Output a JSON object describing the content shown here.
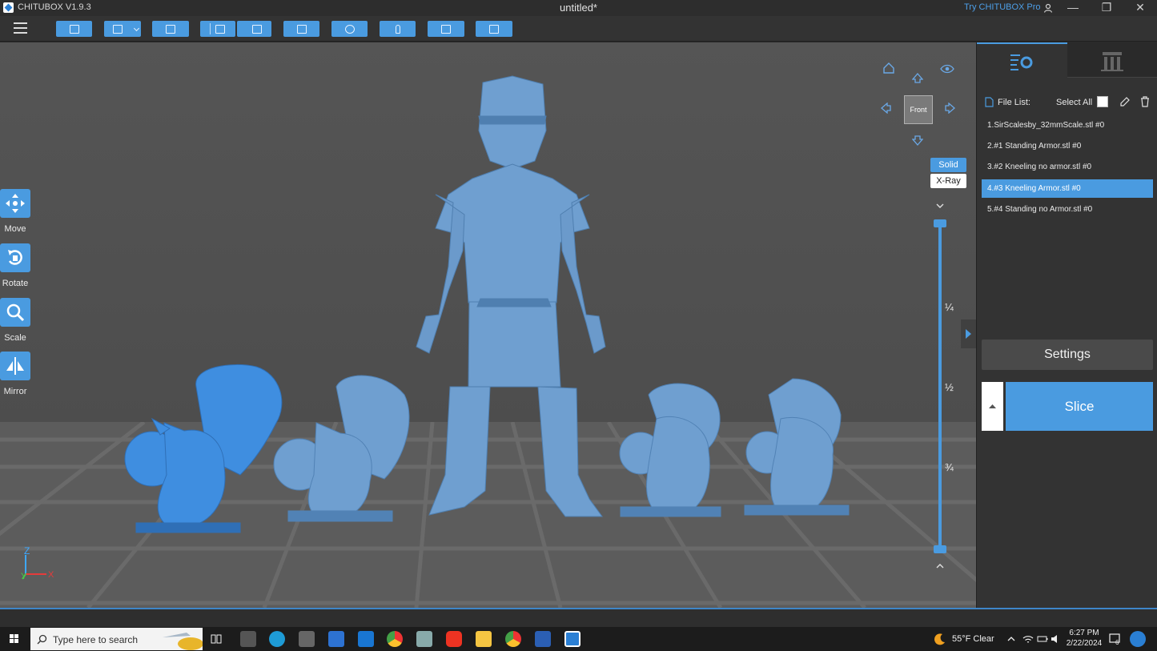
{
  "window": {
    "app_name": "CHITUBOX V1.9.3",
    "document_title": "untitled*",
    "try_pro": "Try CHITUBOX Pro",
    "controls": {
      "minimize": "—",
      "restore": "❐",
      "close": "✕"
    }
  },
  "toolbar": {
    "buttons": [
      "open-file-icon",
      "save-icon",
      "import-icon",
      "undo-icon",
      "redo-icon",
      "copy-icon",
      "arrange-icon",
      "support-icon",
      "hollow-icon",
      "dig-hole-icon"
    ]
  },
  "left_tools": {
    "move": "Move",
    "rotate": "Rotate",
    "scale": "Scale",
    "mirror": "Mirror"
  },
  "viewport": {
    "view_cube_label": "Front",
    "solid": "Solid",
    "xray": "X-Ray",
    "layer_fractions": [
      "¼",
      "½",
      "¾"
    ],
    "axis_z": "Z",
    "axis_y": "Y",
    "axis_x": "X"
  },
  "right_panel": {
    "file_list_label": "File List:",
    "select_all": "Select All",
    "files": [
      "1.SirScalesby_32mmScale.stl #0",
      "2.#1 Standing Armor.stl #0",
      "3.#2 Kneeling no armor.stl #0",
      "4.#3 Kneeling Armor.stl #0",
      "5.#4 Standing no Armor.stl #0"
    ],
    "selected_index": 3,
    "settings": "Settings",
    "slice": "Slice"
  },
  "taskbar": {
    "search_placeholder": "Type here to search",
    "weather": "55°F  Clear",
    "time": "6:27 PM",
    "date": "2/22/2024",
    "notifications": "6"
  },
  "colors": {
    "accent": "#4a9be0",
    "model_blue": "#6f9fd0",
    "model_highlight": "#3f8ee0",
    "panel": "#333333"
  }
}
